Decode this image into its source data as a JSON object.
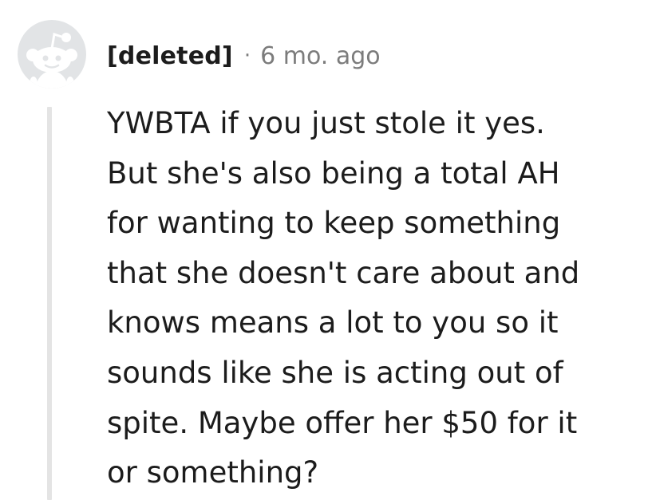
{
  "comment": {
    "author": "[deleted]",
    "separator": "·",
    "timestamp": "6 mo. ago",
    "avatar_icon": "reddit-snoo-icon",
    "body_lines": [
      "YWBTA if you just stole it yes.",
      "But she's also being a total AH",
      "for wanting to keep something",
      "that she doesn't care about and",
      "knows means a lot to you so it",
      "sounds like she is acting out of",
      "spite. Maybe offer her $50 for it",
      "or something?"
    ]
  },
  "colors": {
    "avatar_bg": "#e2e4e6",
    "avatar_fg": "#ffffff",
    "text": "#1c1c1c",
    "meta": "#7c7c7c",
    "thread_line": "#e4e4e4"
  }
}
